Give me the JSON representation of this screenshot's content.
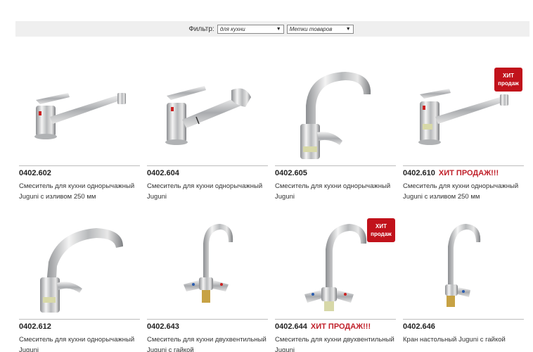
{
  "filter": {
    "label": "Фильтр:",
    "category_selected": "для кухни",
    "tags_selected": "Метки товаров"
  },
  "badge": {
    "line1": "ХИТ",
    "line2": "продаж"
  },
  "products": [
    {
      "code": "0402.602",
      "hot": "",
      "description": "Смеситель для кухни однорычажный Juguni с изливом 250 мм",
      "image": "single-lever-long-spout-faucet",
      "badge": false
    },
    {
      "code": "0402.604",
      "hot": "",
      "description": "Смеситель для кухни однорычажный Juguni",
      "image": "single-lever-pullout-faucet",
      "badge": false
    },
    {
      "code": "0402.605",
      "hot": "",
      "description": "Смеситель для кухни однорычажный Juguni",
      "image": "single-lever-gooseneck-faucet",
      "badge": false
    },
    {
      "code": "0402.610",
      "hot": "ХИТ ПРОДАЖ!!!",
      "description": "Смеситель для кухни однорычажный Juguni с изливом 250 мм",
      "image": "single-lever-long-spout-faucet",
      "badge": true
    },
    {
      "code": "0402.612",
      "hot": "",
      "description": "Смеситель для кухни однорычажный Juguni",
      "image": "single-lever-gooseneck-faucet",
      "badge": false
    },
    {
      "code": "0402.643",
      "hot": "",
      "description": "Смеситель для кухни двухвентильный Juguni с гайкой",
      "image": "two-valve-gooseneck-faucet",
      "badge": false
    },
    {
      "code": "0402.644",
      "hot": "ХИТ ПРОДАЖ!!!",
      "description": "Смеситель для кухни двухвентильный Juguni",
      "image": "two-valve-gooseneck-faucet",
      "badge": true
    },
    {
      "code": "0402.646",
      "hot": "",
      "description": "Кран настольный Juguni с гайкой",
      "image": "single-valve-gooseneck-tap",
      "badge": false
    }
  ],
  "colors": {
    "hot": "#c0202a",
    "badge_bg": "#c1121b",
    "filter_bg": "#efefef"
  }
}
